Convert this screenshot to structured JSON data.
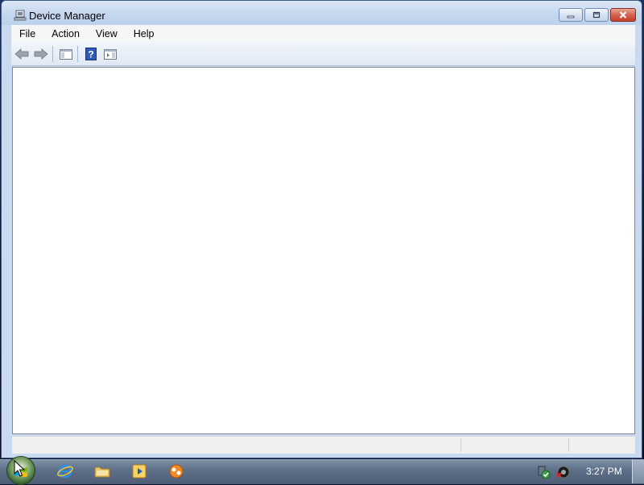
{
  "window": {
    "title": "Device Manager",
    "controls": {
      "minimize_icon": "minimize-icon",
      "maximize_icon": "restore-icon",
      "close_icon": "close-icon"
    }
  },
  "menubar": {
    "items": [
      {
        "label": "File"
      },
      {
        "label": "Action"
      },
      {
        "label": "View"
      },
      {
        "label": "Help"
      }
    ]
  },
  "toolbar": {
    "buttons": [
      {
        "name": "back-button",
        "icon": "back-arrow-icon"
      },
      {
        "name": "forward-button",
        "icon": "forward-arrow-icon"
      },
      {
        "name": "show-hide-console-tree-button",
        "icon": "console-tree-icon"
      },
      {
        "name": "help-button",
        "icon": "help-icon"
      },
      {
        "name": "show-hide-action-pane-button",
        "icon": "action-pane-icon"
      }
    ]
  },
  "taskbar": {
    "start_icon": "start-orb-icon",
    "pinned": [
      {
        "name": "internet-explorer",
        "icon": "internet-explorer-icon"
      },
      {
        "name": "windows-explorer",
        "icon": "folder-icon"
      },
      {
        "name": "media-player",
        "icon": "media-player-icon"
      },
      {
        "name": "app-shortcut",
        "icon": "app-icon"
      }
    ],
    "tray_icons": [
      "action-center-icon",
      "network-disconnected-icon"
    ],
    "clock": "3:27 PM"
  },
  "colors": {
    "titlebar": "#c6d8ef",
    "close_button": "#c2402b",
    "taskbar": "#5f7189",
    "content_bg": "#ffffff"
  }
}
